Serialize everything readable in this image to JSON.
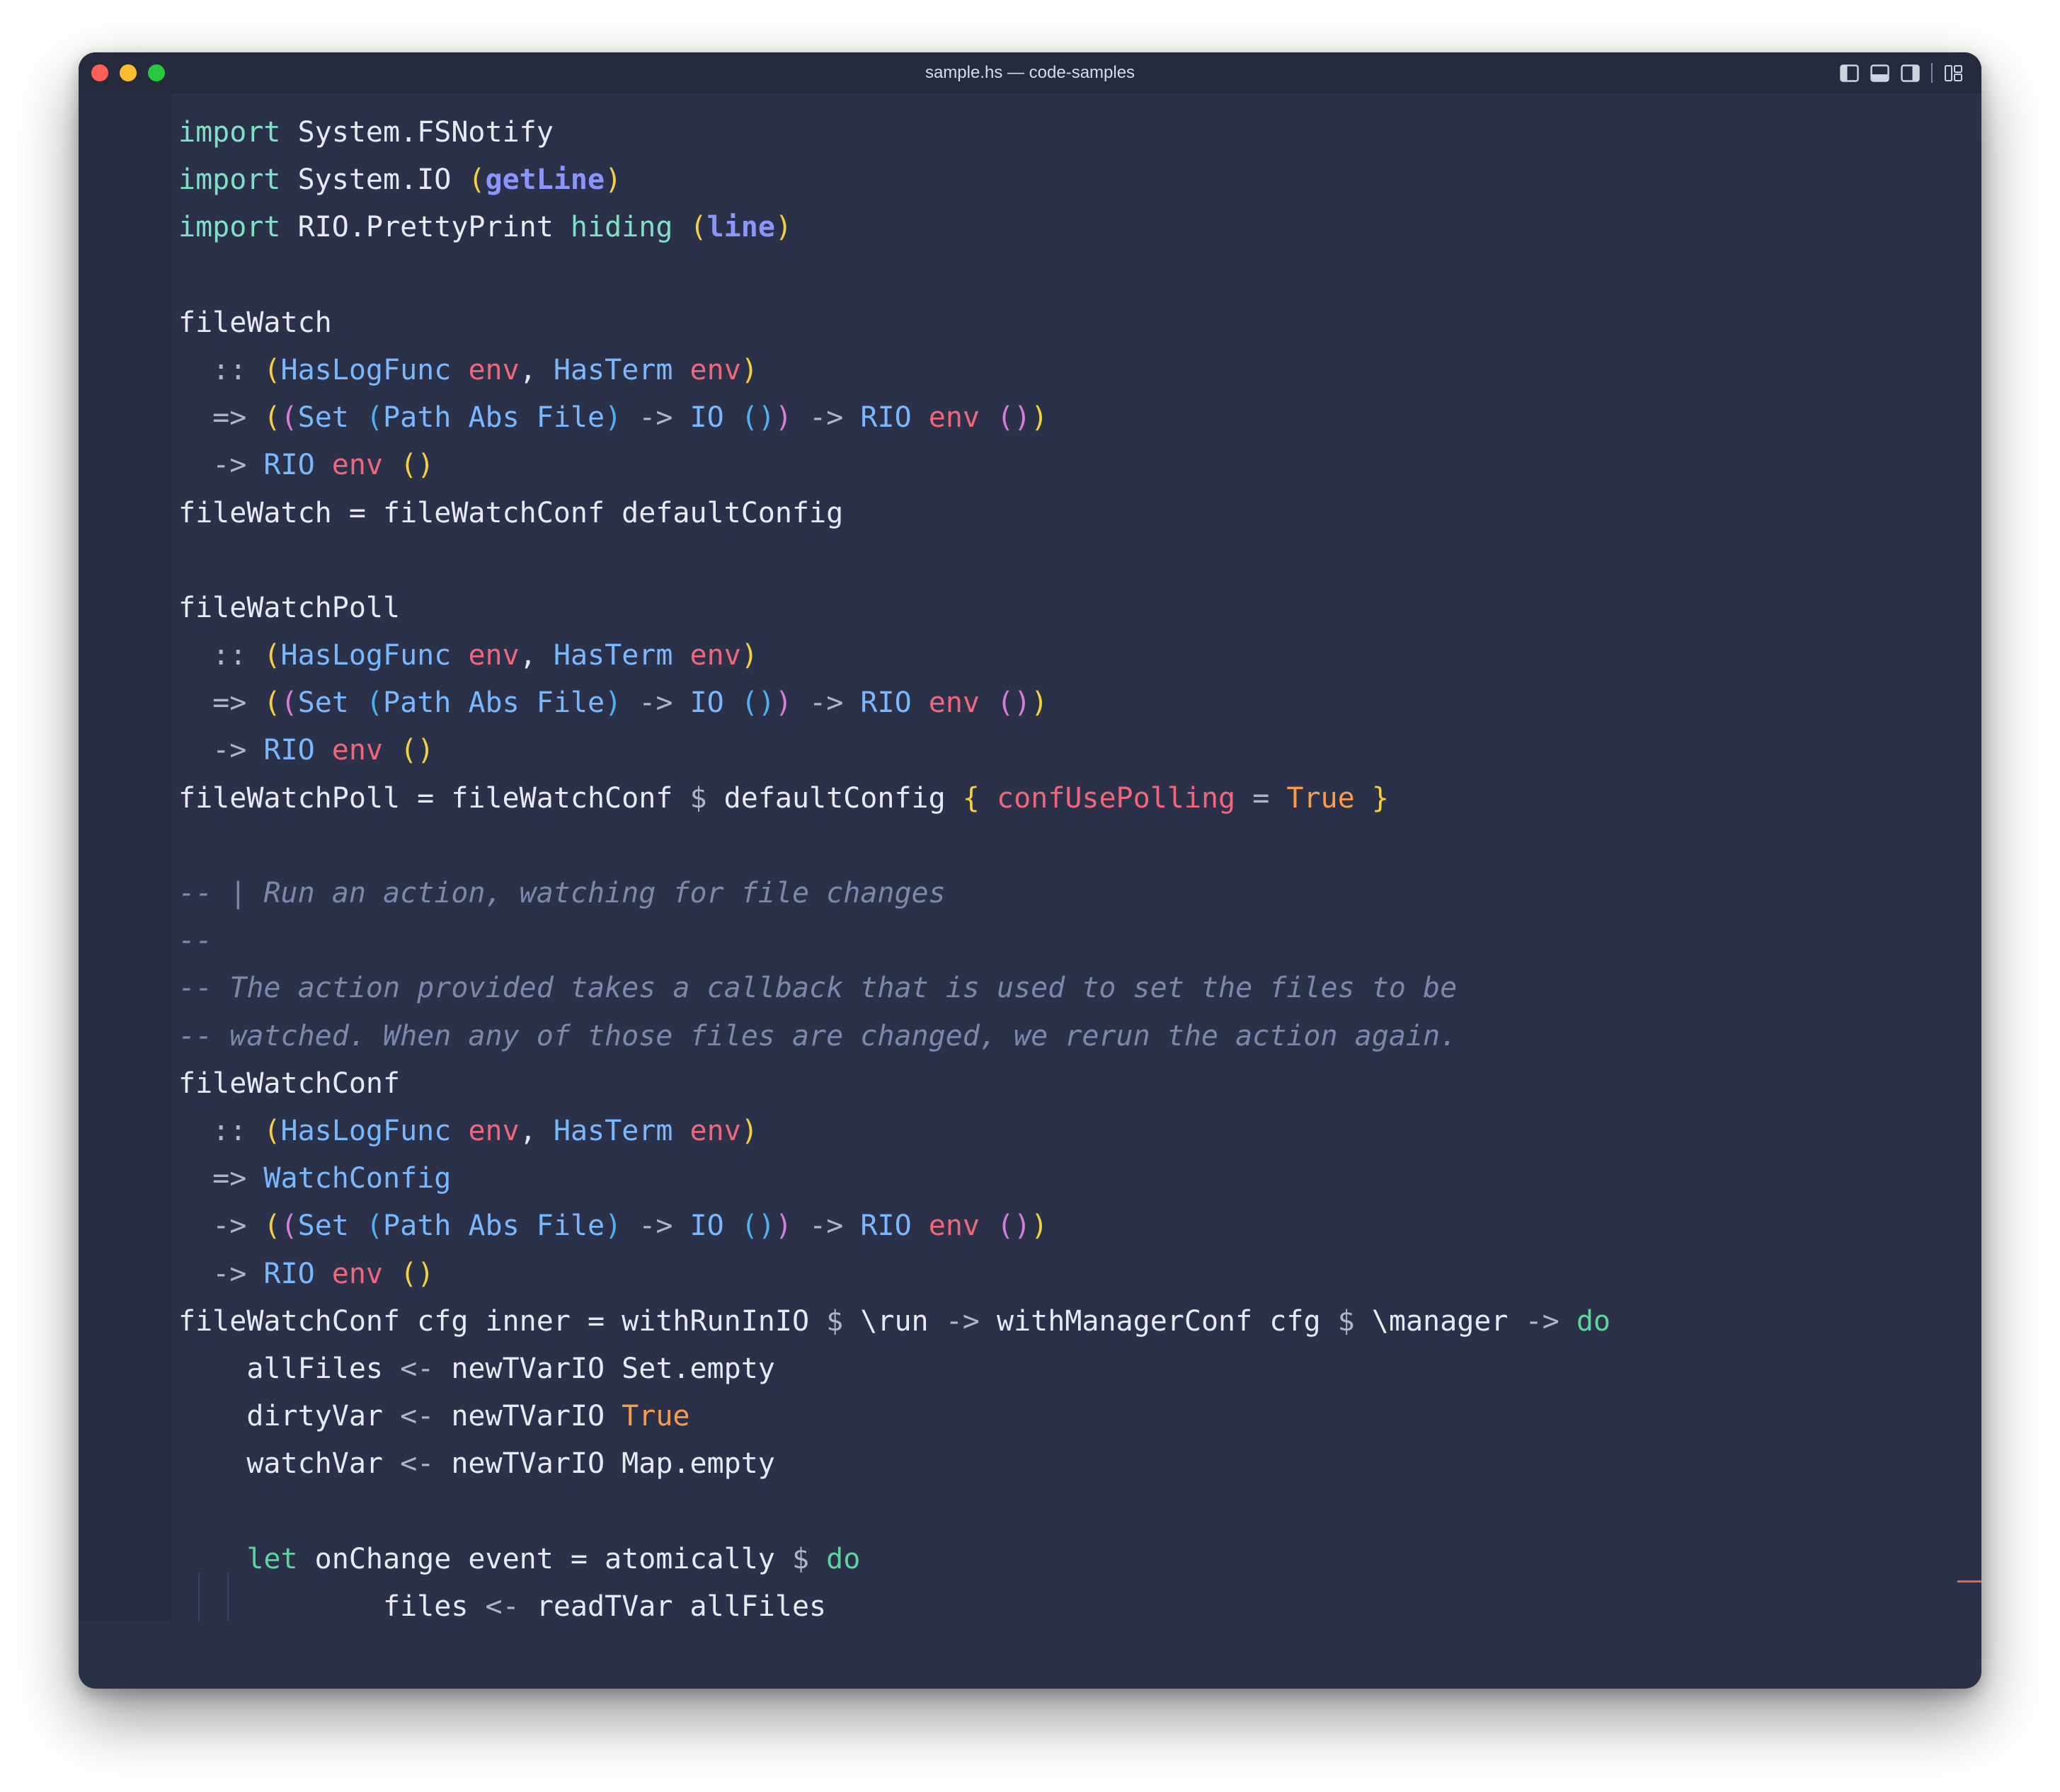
{
  "window": {
    "title": "sample.hs — code-samples"
  },
  "theme": {
    "background": "#2b3149",
    "keyword": "#7fe0c5",
    "type": "#79b8ff",
    "type_variable": "#f0667a",
    "comment": "#7d87aa",
    "boolean": "#f89c4b",
    "bracket_1": "#f4d03f",
    "bracket_2": "#d37fd9",
    "bracket_3": "#4fb1f2"
  },
  "toolbar": {
    "icons": [
      "sidebar-left-icon",
      "panel-bottom-icon",
      "sidebar-right-icon",
      "layout-customize-icon"
    ]
  },
  "code": [
    [
      {
        "t": "import",
        "c": "kw"
      },
      {
        "t": " System.FSNotify",
        "c": "mod"
      }
    ],
    [
      {
        "t": "import",
        "c": "kw"
      },
      {
        "t": " System.IO ",
        "c": "mod"
      },
      {
        "t": "(",
        "c": "b1"
      },
      {
        "t": "getLine",
        "c": "fn"
      },
      {
        "t": ")",
        "c": "b1"
      }
    ],
    [
      {
        "t": "import",
        "c": "kw"
      },
      {
        "t": " RIO.PrettyPrint ",
        "c": "mod"
      },
      {
        "t": "hiding",
        "c": "kw"
      },
      {
        "t": " ",
        "c": ""
      },
      {
        "t": "(",
        "c": "b1"
      },
      {
        "t": "line",
        "c": "fn"
      },
      {
        "t": ")",
        "c": "b1"
      }
    ],
    [],
    [
      {
        "t": "fileWatch",
        "c": ""
      }
    ],
    [
      {
        "t": "  :: ",
        "c": "op"
      },
      {
        "t": "(",
        "c": "b1"
      },
      {
        "t": "HasLogFunc",
        "c": "ty"
      },
      {
        "t": " ",
        "c": ""
      },
      {
        "t": "env",
        "c": "tv"
      },
      {
        "t": ", ",
        "c": ""
      },
      {
        "t": "HasTerm",
        "c": "ty"
      },
      {
        "t": " ",
        "c": ""
      },
      {
        "t": "env",
        "c": "tv"
      },
      {
        "t": ")",
        "c": "b1"
      }
    ],
    [
      {
        "t": "  => ",
        "c": "op"
      },
      {
        "t": "(",
        "c": "b1"
      },
      {
        "t": "(",
        "c": "b2"
      },
      {
        "t": "Set",
        "c": "ty"
      },
      {
        "t": " ",
        "c": ""
      },
      {
        "t": "(",
        "c": "b3"
      },
      {
        "t": "Path Abs File",
        "c": "ty"
      },
      {
        "t": ")",
        "c": "b3"
      },
      {
        "t": " -> ",
        "c": "op"
      },
      {
        "t": "IO",
        "c": "ty"
      },
      {
        "t": " ",
        "c": ""
      },
      {
        "t": "()",
        "c": "b3"
      },
      {
        "t": ")",
        "c": "b2"
      },
      {
        "t": " -> ",
        "c": "op"
      },
      {
        "t": "RIO",
        "c": "ty"
      },
      {
        "t": " ",
        "c": ""
      },
      {
        "t": "env",
        "c": "tv"
      },
      {
        "t": " ",
        "c": ""
      },
      {
        "t": "()",
        "c": "b2"
      },
      {
        "t": ")",
        "c": "b1"
      }
    ],
    [
      {
        "t": "  -> ",
        "c": "op"
      },
      {
        "t": "RIO",
        "c": "ty"
      },
      {
        "t": " ",
        "c": ""
      },
      {
        "t": "env",
        "c": "tv"
      },
      {
        "t": " ",
        "c": ""
      },
      {
        "t": "()",
        "c": "b1"
      }
    ],
    [
      {
        "t": "fileWatch = fileWatchConf defaultConfig",
        "c": ""
      }
    ],
    [],
    [
      {
        "t": "fileWatchPoll",
        "c": ""
      }
    ],
    [
      {
        "t": "  :: ",
        "c": "op"
      },
      {
        "t": "(",
        "c": "b1"
      },
      {
        "t": "HasLogFunc",
        "c": "ty"
      },
      {
        "t": " ",
        "c": ""
      },
      {
        "t": "env",
        "c": "tv"
      },
      {
        "t": ", ",
        "c": ""
      },
      {
        "t": "HasTerm",
        "c": "ty"
      },
      {
        "t": " ",
        "c": ""
      },
      {
        "t": "env",
        "c": "tv"
      },
      {
        "t": ")",
        "c": "b1"
      }
    ],
    [
      {
        "t": "  => ",
        "c": "op"
      },
      {
        "t": "(",
        "c": "b1"
      },
      {
        "t": "(",
        "c": "b2"
      },
      {
        "t": "Set",
        "c": "ty"
      },
      {
        "t": " ",
        "c": ""
      },
      {
        "t": "(",
        "c": "b3"
      },
      {
        "t": "Path Abs File",
        "c": "ty"
      },
      {
        "t": ")",
        "c": "b3"
      },
      {
        "t": " -> ",
        "c": "op"
      },
      {
        "t": "IO",
        "c": "ty"
      },
      {
        "t": " ",
        "c": ""
      },
      {
        "t": "()",
        "c": "b3"
      },
      {
        "t": ")",
        "c": "b2"
      },
      {
        "t": " -> ",
        "c": "op"
      },
      {
        "t": "RIO",
        "c": "ty"
      },
      {
        "t": " ",
        "c": ""
      },
      {
        "t": "env",
        "c": "tv"
      },
      {
        "t": " ",
        "c": ""
      },
      {
        "t": "()",
        "c": "b2"
      },
      {
        "t": ")",
        "c": "b1"
      }
    ],
    [
      {
        "t": "  -> ",
        "c": "op"
      },
      {
        "t": "RIO",
        "c": "ty"
      },
      {
        "t": " ",
        "c": ""
      },
      {
        "t": "env",
        "c": "tv"
      },
      {
        "t": " ",
        "c": ""
      },
      {
        "t": "()",
        "c": "b1"
      }
    ],
    [
      {
        "t": "fileWatchPoll = fileWatchConf ",
        "c": ""
      },
      {
        "t": "$",
        "c": "op"
      },
      {
        "t": " defaultConfig ",
        "c": ""
      },
      {
        "t": "{",
        "c": "b1"
      },
      {
        "t": " ",
        "c": ""
      },
      {
        "t": "confUsePolling",
        "c": "fld"
      },
      {
        "t": " = ",
        "c": "op"
      },
      {
        "t": "True",
        "c": "bool"
      },
      {
        "t": " ",
        "c": ""
      },
      {
        "t": "}",
        "c": "b1"
      }
    ],
    [],
    [
      {
        "t": "-- | Run an action, watching for file changes",
        "c": "cm"
      }
    ],
    [
      {
        "t": "--",
        "c": "cm"
      }
    ],
    [
      {
        "t": "-- The action provided takes a callback that is used to set the files to be",
        "c": "cm"
      }
    ],
    [
      {
        "t": "-- watched. When any of those files are changed, we rerun the action again.",
        "c": "cm"
      }
    ],
    [
      {
        "t": "fileWatchConf",
        "c": ""
      }
    ],
    [
      {
        "t": "  :: ",
        "c": "op"
      },
      {
        "t": "(",
        "c": "b1"
      },
      {
        "t": "HasLogFunc",
        "c": "ty"
      },
      {
        "t": " ",
        "c": ""
      },
      {
        "t": "env",
        "c": "tv"
      },
      {
        "t": ", ",
        "c": ""
      },
      {
        "t": "HasTerm",
        "c": "ty"
      },
      {
        "t": " ",
        "c": ""
      },
      {
        "t": "env",
        "c": "tv"
      },
      {
        "t": ")",
        "c": "b1"
      }
    ],
    [
      {
        "t": "  => ",
        "c": "op"
      },
      {
        "t": "WatchConfig",
        "c": "ty"
      }
    ],
    [
      {
        "t": "  -> ",
        "c": "op"
      },
      {
        "t": "(",
        "c": "b1"
      },
      {
        "t": "(",
        "c": "b2"
      },
      {
        "t": "Set",
        "c": "ty"
      },
      {
        "t": " ",
        "c": ""
      },
      {
        "t": "(",
        "c": "b3"
      },
      {
        "t": "Path Abs File",
        "c": "ty"
      },
      {
        "t": ")",
        "c": "b3"
      },
      {
        "t": " -> ",
        "c": "op"
      },
      {
        "t": "IO",
        "c": "ty"
      },
      {
        "t": " ",
        "c": ""
      },
      {
        "t": "()",
        "c": "b3"
      },
      {
        "t": ")",
        "c": "b2"
      },
      {
        "t": " -> ",
        "c": "op"
      },
      {
        "t": "RIO",
        "c": "ty"
      },
      {
        "t": " ",
        "c": ""
      },
      {
        "t": "env",
        "c": "tv"
      },
      {
        "t": " ",
        "c": ""
      },
      {
        "t": "()",
        "c": "b2"
      },
      {
        "t": ")",
        "c": "b1"
      }
    ],
    [
      {
        "t": "  -> ",
        "c": "op"
      },
      {
        "t": "RIO",
        "c": "ty"
      },
      {
        "t": " ",
        "c": ""
      },
      {
        "t": "env",
        "c": "tv"
      },
      {
        "t": " ",
        "c": ""
      },
      {
        "t": "()",
        "c": "b1"
      }
    ],
    [
      {
        "t": "fileWatchConf cfg inner = withRunInIO ",
        "c": ""
      },
      {
        "t": "$",
        "c": "op"
      },
      {
        "t": " \\run ",
        "c": ""
      },
      {
        "t": "->",
        "c": "op"
      },
      {
        "t": " withManagerConf cfg ",
        "c": ""
      },
      {
        "t": "$",
        "c": "op"
      },
      {
        "t": " \\manager ",
        "c": ""
      },
      {
        "t": "->",
        "c": "op"
      },
      {
        "t": " ",
        "c": ""
      },
      {
        "t": "do",
        "c": "do"
      }
    ],
    [
      {
        "t": "    allFiles ",
        "c": ""
      },
      {
        "t": "<-",
        "c": "op"
      },
      {
        "t": " newTVarIO Set.empty",
        "c": ""
      }
    ],
    [
      {
        "t": "    dirtyVar ",
        "c": ""
      },
      {
        "t": "<-",
        "c": "op"
      },
      {
        "t": " newTVarIO ",
        "c": ""
      },
      {
        "t": "True",
        "c": "bool"
      }
    ],
    [
      {
        "t": "    watchVar ",
        "c": ""
      },
      {
        "t": "<-",
        "c": "op"
      },
      {
        "t": " newTVarIO Map.empty",
        "c": ""
      }
    ],
    [],
    [
      {
        "t": "    ",
        "c": ""
      },
      {
        "t": "let",
        "c": "do"
      },
      {
        "t": " onChange event = atomically ",
        "c": ""
      },
      {
        "t": "$",
        "c": "op"
      },
      {
        "t": " ",
        "c": ""
      },
      {
        "t": "do",
        "c": "do"
      }
    ],
    [
      {
        "t": "            files ",
        "c": ""
      },
      {
        "t": "<-",
        "c": "op"
      },
      {
        "t": " readTVar allFiles",
        "c": ""
      }
    ]
  ]
}
